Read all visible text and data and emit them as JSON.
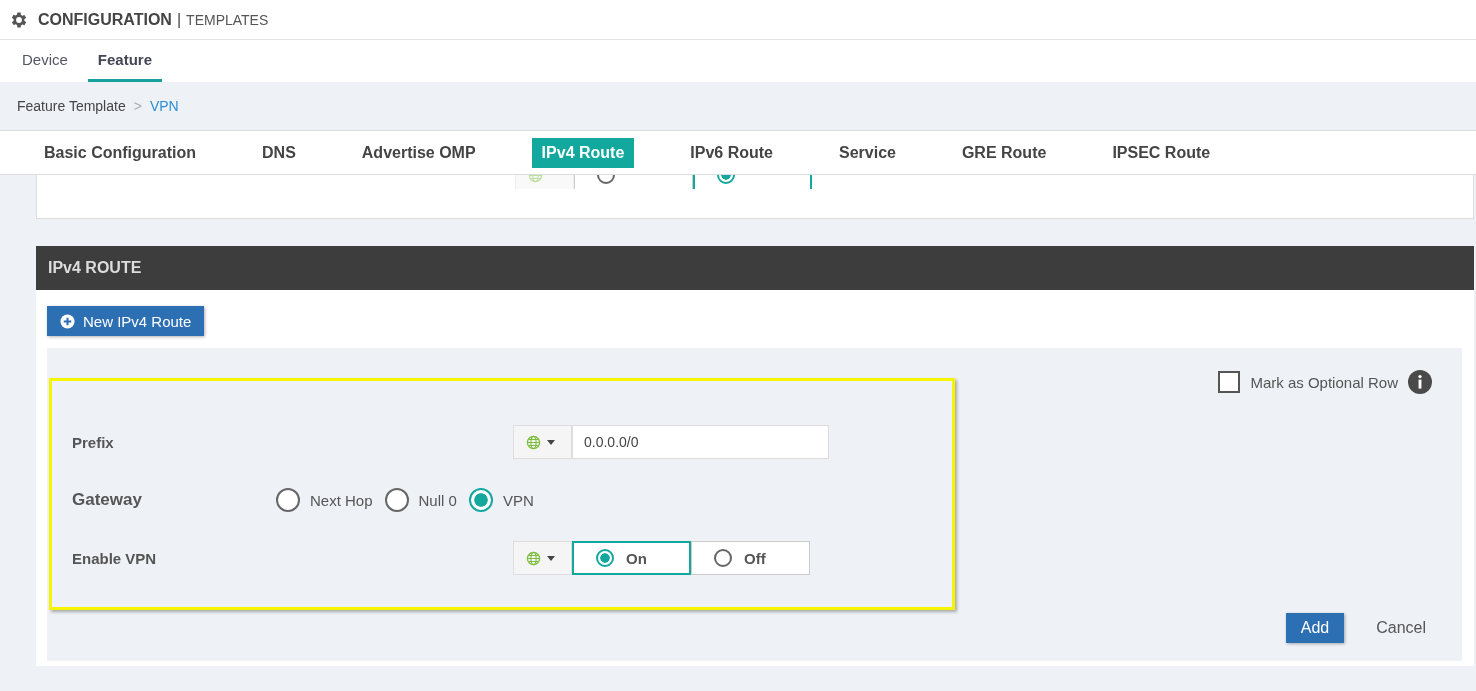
{
  "header": {
    "title": "CONFIGURATION",
    "separator": "|",
    "subtitle": "TEMPLATES"
  },
  "nav_tabs": [
    {
      "label": "Device",
      "selected": false
    },
    {
      "label": "Feature",
      "selected": true
    }
  ],
  "breadcrumb": {
    "items": [
      "Feature Template",
      "VPN"
    ],
    "separator": ">"
  },
  "section_tabs": [
    {
      "label": "Basic Configuration",
      "selected": false
    },
    {
      "label": "DNS",
      "selected": false
    },
    {
      "label": "Advertise OMP",
      "selected": false
    },
    {
      "label": "IPv4 Route",
      "selected": true
    },
    {
      "label": "IPv6 Route",
      "selected": false
    },
    {
      "label": "Service",
      "selected": false
    },
    {
      "label": "GRE Route",
      "selected": false
    },
    {
      "label": "IPSEC Route",
      "selected": false
    }
  ],
  "network_row": {
    "options": [
      {
        "selected": false
      },
      {
        "selected": true
      }
    ]
  },
  "route_section": {
    "title": "IPv4 ROUTE",
    "new_button": "New IPv4 Route",
    "optional_row": {
      "label": "Mark as Optional Row",
      "checked": false
    },
    "fields": [
      {
        "kind": "input",
        "label": "Prefix",
        "value": "0.0.0.0/0"
      },
      {
        "kind": "radio",
        "label": "Gateway",
        "options": [
          {
            "label": "Next Hop",
            "selected": false
          },
          {
            "label": "Null 0",
            "selected": false
          },
          {
            "label": "VPN",
            "selected": true
          }
        ]
      },
      {
        "kind": "toggle",
        "label": "Enable VPN",
        "options": [
          {
            "label": "On",
            "selected": true
          },
          {
            "label": "Off",
            "selected": false
          }
        ]
      }
    ],
    "buttons": {
      "add": "Add",
      "cancel": "Cancel"
    }
  }
}
